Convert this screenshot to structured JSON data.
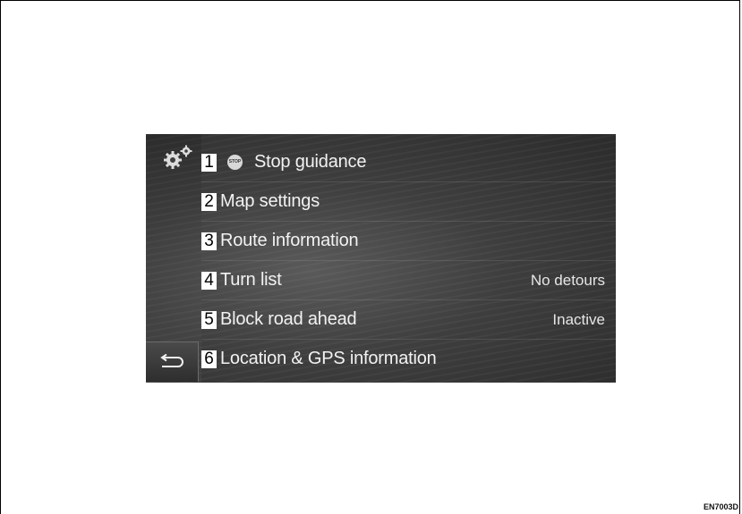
{
  "menu": {
    "items": [
      {
        "number": "1",
        "label": "Stop guidance",
        "status": "",
        "icon": "stop-icon",
        "icon_text": "STOP"
      },
      {
        "number": "2",
        "label": "Map settings",
        "status": ""
      },
      {
        "number": "3",
        "label": "Route information",
        "status": ""
      },
      {
        "number": "4",
        "label": "Turn list",
        "status": "No detours"
      },
      {
        "number": "5",
        "label": "Block road ahead",
        "status": "Inactive"
      },
      {
        "number": "6",
        "label": "Location & GPS information",
        "status": ""
      }
    ]
  },
  "icons": {
    "settings": "gears-icon",
    "back": "back-arrow-icon"
  },
  "colors": {
    "screen_bg": "#3e3e3e",
    "badge_bg": "#ffffff",
    "text": "#f2f2f2"
  },
  "figure_code": "EN7003D"
}
